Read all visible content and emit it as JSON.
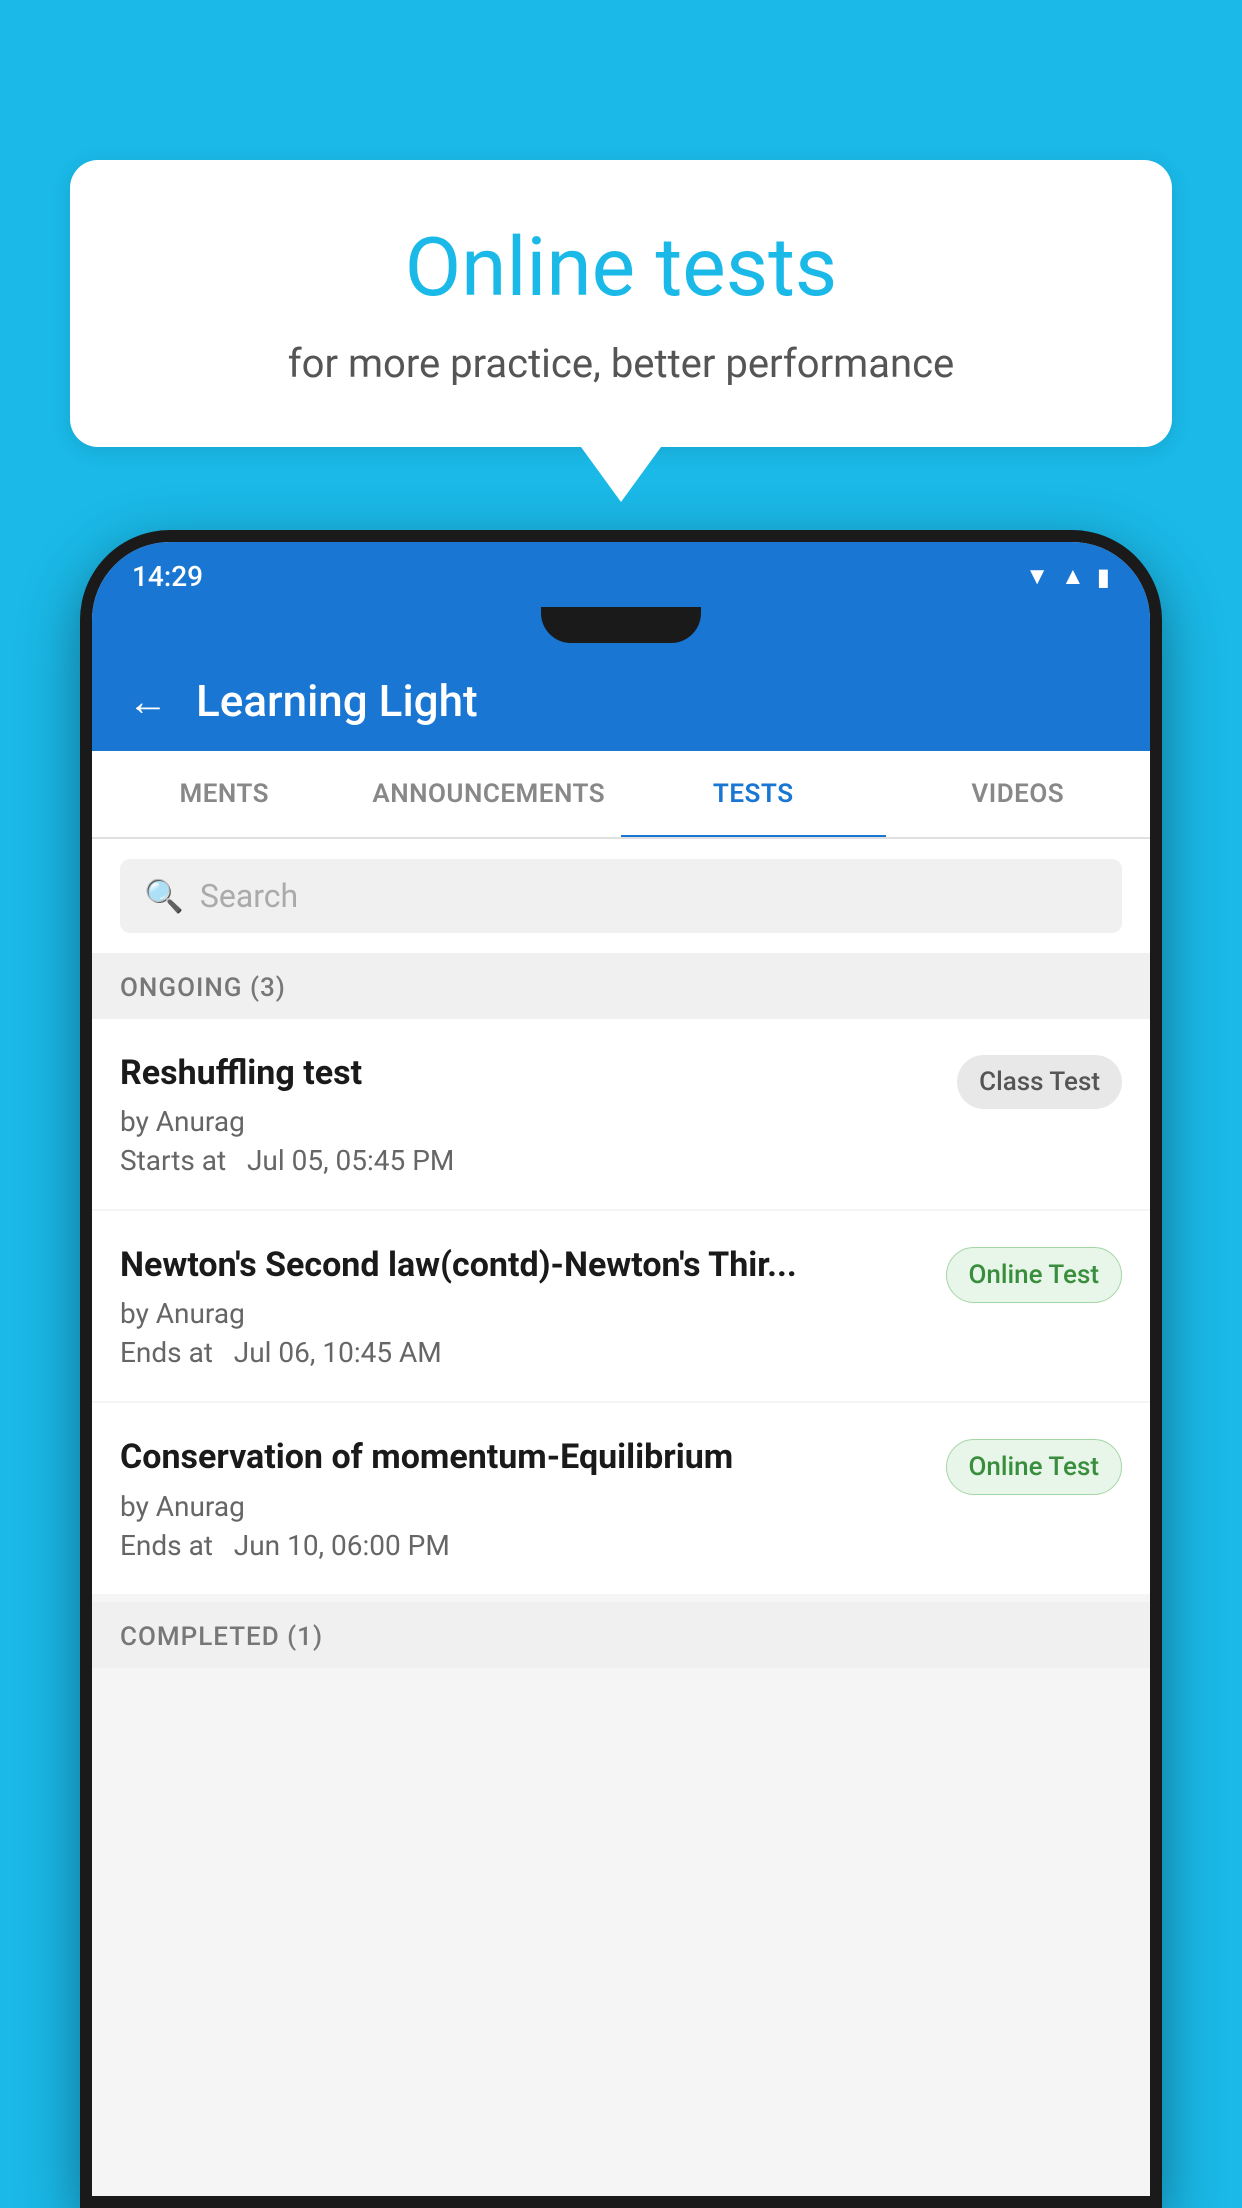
{
  "background_color": "#1ab9e8",
  "speech_bubble": {
    "title": "Online tests",
    "subtitle": "for more practice, better performance"
  },
  "phone": {
    "status_bar": {
      "time": "14:29",
      "icons": [
        "wifi",
        "signal",
        "battery"
      ]
    },
    "app_bar": {
      "title": "Learning Light",
      "back_label": "←"
    },
    "tabs": [
      {
        "label": "MENTS",
        "active": false
      },
      {
        "label": "ANNOUNCEMENTS",
        "active": false
      },
      {
        "label": "TESTS",
        "active": true
      },
      {
        "label": "VIDEOS",
        "active": false
      }
    ],
    "search": {
      "placeholder": "Search"
    },
    "ongoing_section": {
      "header": "ONGOING (3)",
      "items": [
        {
          "title": "Reshuffling test",
          "author": "by Anurag",
          "date": "Starts at  Jul 05, 05:45 PM",
          "badge": "Class Test",
          "badge_type": "class"
        },
        {
          "title": "Newton's Second law(contd)-Newton's Thir...",
          "author": "by Anurag",
          "date": "Ends at  Jul 06, 10:45 AM",
          "badge": "Online Test",
          "badge_type": "online"
        },
        {
          "title": "Conservation of momentum-Equilibrium",
          "author": "by Anurag",
          "date": "Ends at  Jun 10, 06:00 PM",
          "badge": "Online Test",
          "badge_type": "online"
        }
      ]
    },
    "completed_section": {
      "header": "COMPLETED (1)"
    }
  }
}
